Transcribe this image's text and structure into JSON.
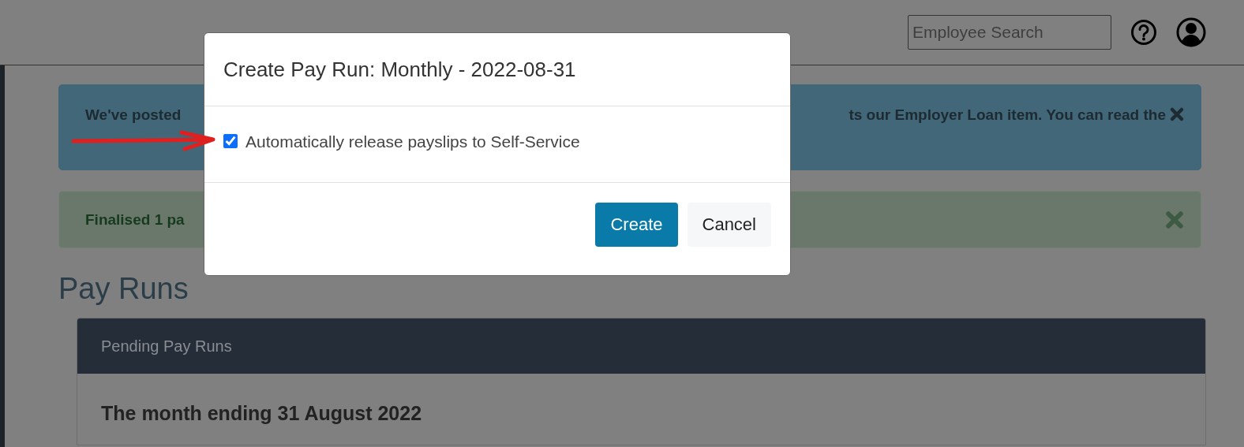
{
  "header": {
    "search": {
      "placeholder": "Employee Search"
    }
  },
  "alerts": [
    {
      "kind": "info",
      "text_left": "We've posted",
      "text_right": "ts our Employer Loan item. You can read the"
    },
    {
      "kind": "success",
      "text_left": "Finalised 1 pa"
    }
  ],
  "page_title": "Pay Runs",
  "card": {
    "header": "Pending Pay Runs",
    "item_title": "The month ending 31 August 2022"
  },
  "modal": {
    "title": "Create Pay Run: Monthly - 2022-08-31",
    "option": {
      "label": "Automatically release payslips to Self-Service",
      "checked": true
    },
    "buttons": [
      {
        "label": "Create",
        "kind": "primary"
      },
      {
        "label": "Cancel",
        "kind": "secondary"
      }
    ]
  }
}
